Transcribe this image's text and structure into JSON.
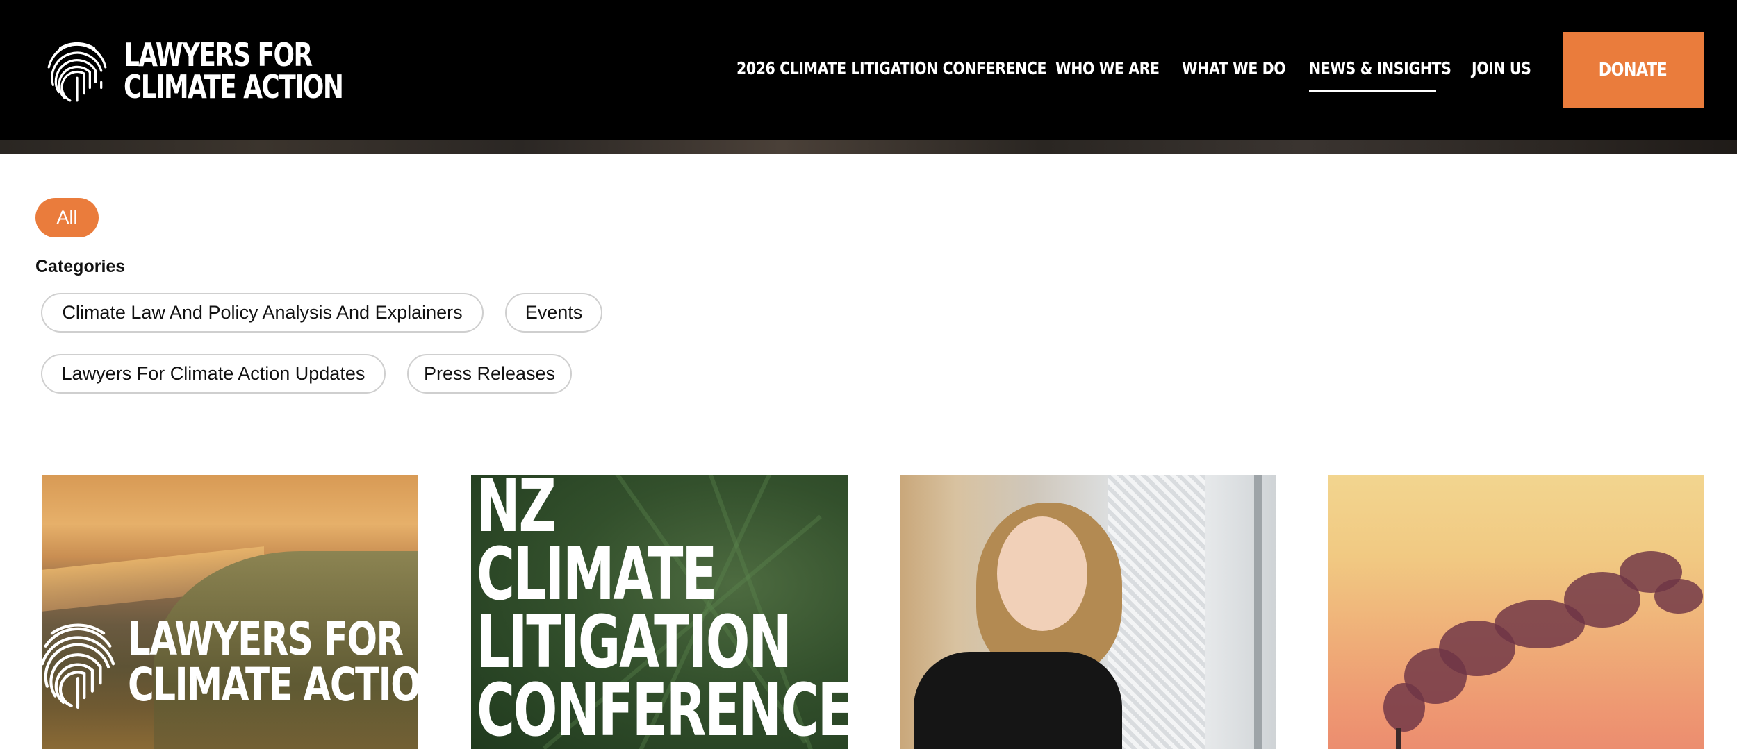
{
  "brand": {
    "name_line1": "LAWYERS FOR",
    "name_line2": "CLIMATE ACTION",
    "logo_icon": "fingerprint-icon",
    "accent_color": "#ea7c3c"
  },
  "nav": {
    "items": [
      {
        "label": "2026 CLIMATE LITIGATION CONFERENCE",
        "active": false
      },
      {
        "label": "WHO WE ARE",
        "active": false
      },
      {
        "label": "WHAT WE DO",
        "active": false
      },
      {
        "label": "NEWS & INSIGHTS",
        "active": true
      },
      {
        "label": "JOIN US",
        "active": false
      }
    ],
    "donate_label": "DONATE"
  },
  "filters": {
    "all_label": "All",
    "all_selected": true,
    "categories_heading": "Categories",
    "categories": [
      "Climate Law And Policy Analysis And Explainers",
      "Events",
      "Lawyers For Climate Action Updates",
      "Press Releases"
    ]
  },
  "cards": [
    {
      "image": "coastal-dunes-with-logo",
      "overlay_line1": "LAWYERS FOR",
      "overlay_line2": "CLIMATE ACTIO"
    },
    {
      "image": "fern-background",
      "title_lines": [
        "NZ",
        "CLIMATE",
        "LITIGATION",
        "CONFERENCE"
      ]
    },
    {
      "image": "smiling-woman-portrait"
    },
    {
      "image": "smokestack-sunset"
    }
  ]
}
